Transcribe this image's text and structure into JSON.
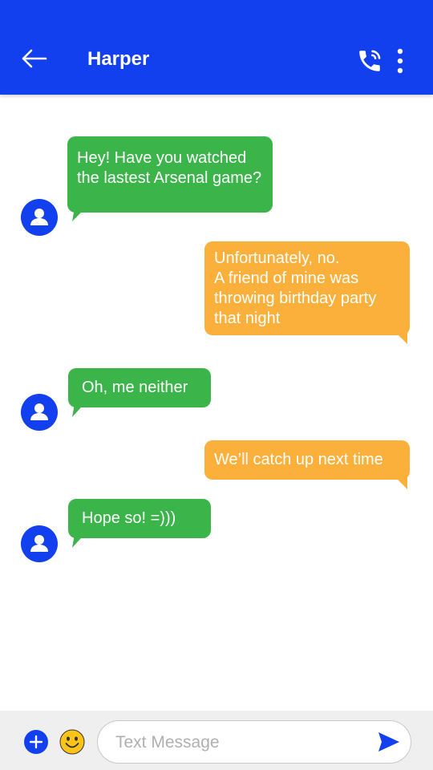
{
  "header": {
    "title": "Harper",
    "back_icon": "arrow-left-icon",
    "call_icon": "phone-icon",
    "more_icon": "more-vertical-icon",
    "background": "#1340ee"
  },
  "messages": [
    {
      "direction": "incoming",
      "lines": [
        "Hey! Have you watched",
        "the lastest Arsenal game?"
      ]
    },
    {
      "direction": "outgoing",
      "lines": [
        "Unfortunately, no.",
        "A friend of mine was",
        "throwing birthday party",
        "that night"
      ]
    },
    {
      "direction": "incoming",
      "lines": [
        "Oh, me neither"
      ]
    },
    {
      "direction": "outgoing",
      "lines": [
        "We’ll catch up next time"
      ]
    },
    {
      "direction": "incoming",
      "lines": [
        "Hope so! =)))"
      ]
    }
  ],
  "colors": {
    "incoming_bubble": "#3bb54a",
    "outgoing_bubble": "#fbb03b",
    "avatar": "#1340ee"
  },
  "composer": {
    "placeholder": "Text Message",
    "value": "",
    "add_icon": "plus-circle-icon",
    "emoji_icon": "smiley-icon",
    "send_icon": "send-icon"
  }
}
